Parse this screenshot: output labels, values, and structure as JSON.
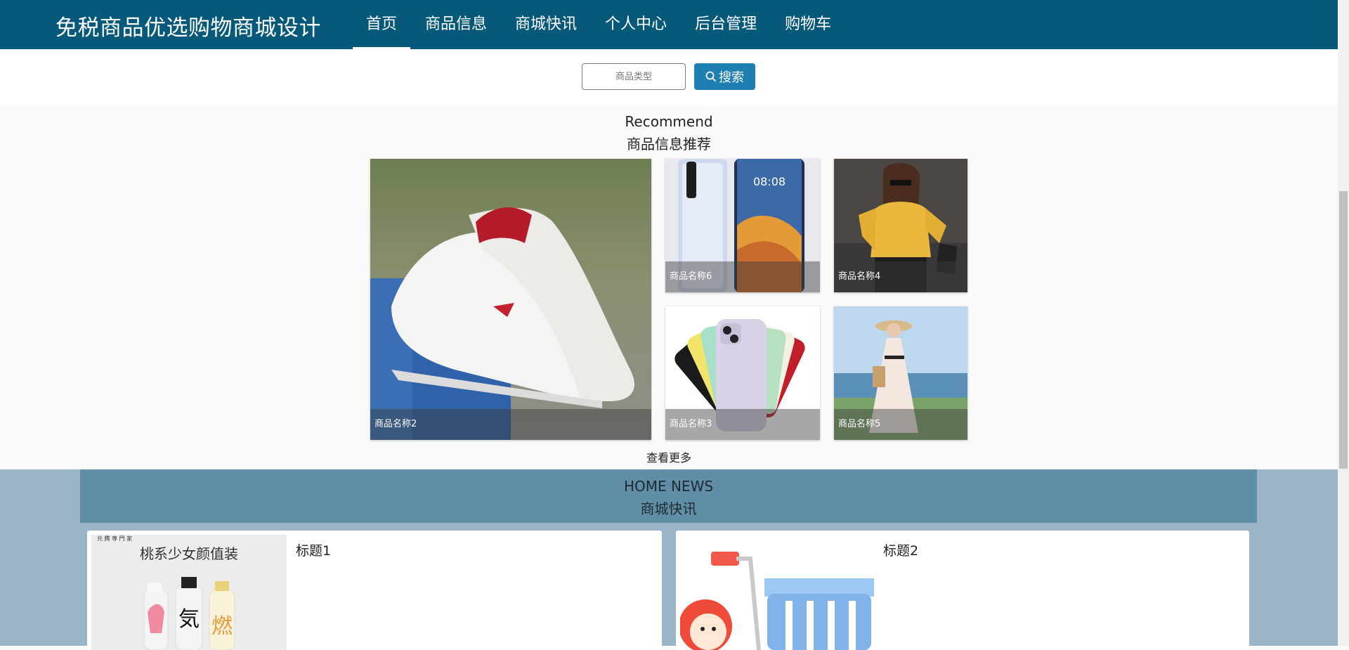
{
  "header": {
    "brand": "免税商品优选购物商城设计",
    "nav": [
      "首页",
      "商品信息",
      "商城快讯",
      "个人中心",
      "后台管理",
      "购物车"
    ],
    "active_nav": "首页"
  },
  "search": {
    "placeholder": "商品类型",
    "button_label": "搜索"
  },
  "recommend": {
    "title_en": "Recommend",
    "title_cn": "商品信息推荐",
    "items": [
      {
        "name": "商品名称2",
        "icon": "sneaker-photo"
      },
      {
        "name": "商品名称6",
        "icon": "phone-photo"
      },
      {
        "name": "商品名称4",
        "icon": "sweater-photo"
      },
      {
        "name": "商品名称3",
        "icon": "iphone-photo"
      },
      {
        "name": "商品名称5",
        "icon": "dress-photo"
      }
    ],
    "more_label": "查看更多"
  },
  "news": {
    "title_en": "HOME NEWS",
    "title_cn": "商城快讯",
    "items": [
      {
        "title": "标题1",
        "thumb_text": "桃系少女颜值装",
        "thumb_header": "元 腾 専 門 家"
      },
      {
        "title": "标题2",
        "icon": "shopping-cart-cartoon"
      }
    ]
  },
  "colors": {
    "header_bg": "#07597a",
    "search_button": "#1e7fb2",
    "news_bg": "#9ab5c8",
    "news_header": "#5f8ea6"
  }
}
